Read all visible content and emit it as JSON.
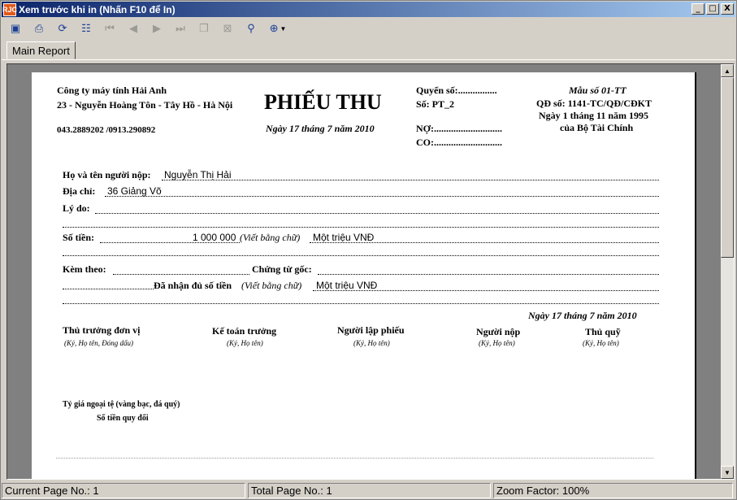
{
  "window": {
    "app_icon_text": "RJC",
    "title": "Xem trước khi in (Nhấn F10 để In)",
    "buttons": {
      "minimize": "_",
      "maximize": "□",
      "close": "X"
    }
  },
  "toolbar": {
    "icons": [
      "export-icon",
      "print-icon",
      "refresh-icon",
      "tree-icon",
      "first-page-icon",
      "prev-page-icon",
      "next-page-icon",
      "last-page-icon",
      "copy-icon",
      "cancel-icon",
      "find-icon",
      "zoom-icon"
    ]
  },
  "tabs": [
    {
      "label": "Main Report"
    }
  ],
  "report": {
    "company_name": "Công ty máy tính Hải Anh",
    "company_address": "23 - Nguyễn Hoàng Tôn - Tây Hồ - Hà Nội",
    "company_phone": "043.2889202 /0913.290892",
    "title": "PHIẾU THU",
    "date": "Ngày 17 tháng 7 năm 2010",
    "book_label": "Quyển số:................",
    "number_label": "Số: PT_2",
    "debit_label": "NỢ:............................",
    "credit_label": "CO:............................",
    "form_number": "Mẫu số 01-TT",
    "decision": "QĐ số: 1141-TC/QĐ/CĐKT",
    "decision_date": "Ngày 1 tháng 11 năm 1995",
    "issuer": "của Bộ Tài Chính",
    "payer_label": "Họ và tên người nộp:",
    "payer_value": "Nguyễn Thị Hải",
    "address_label": "Địa chỉ:",
    "address_value": "36 Giảng Võ",
    "reason_label": "Lý do:",
    "amount_label": "Số tiền:",
    "amount_value": "1 000 000",
    "in_words_label": "(Viết bằng chữ)",
    "amount_words": "Một triệu  VNĐ",
    "attached_label": "Kèm theo:",
    "original_docs_label": "Chứng từ gốc:",
    "received_label": "Đã nhận đủ số tiền",
    "received_in_words_label": "(Viết bằng chữ)",
    "received_words": "Một triệu  VNĐ",
    "sign_date": "Ngày 17 tháng 7 năm 2010",
    "signatures": [
      {
        "role": "Thủ trưởng đơn vị",
        "note": "(Ký, Họ tên, Đóng dấu)"
      },
      {
        "role": "Kế toán trưởng",
        "note": "(Ký, Họ tên)"
      },
      {
        "role": "Người lập phiếu",
        "note": "(Ký, Họ tên)"
      },
      {
        "role": "Người nộp",
        "note": "(Ký, Họ tên)"
      },
      {
        "role": "Thủ quỹ",
        "note": "(Ký, Họ tên)"
      }
    ],
    "exchange_rate_label": "Tỷ giá ngoại tệ (vàng bạc, đá quý)",
    "converted_label": "Số tiền quy đổi"
  },
  "status": {
    "current_page": "Current Page No.: 1",
    "total_page": "Total Page No.: 1",
    "zoom": "Zoom Factor: 100%"
  }
}
